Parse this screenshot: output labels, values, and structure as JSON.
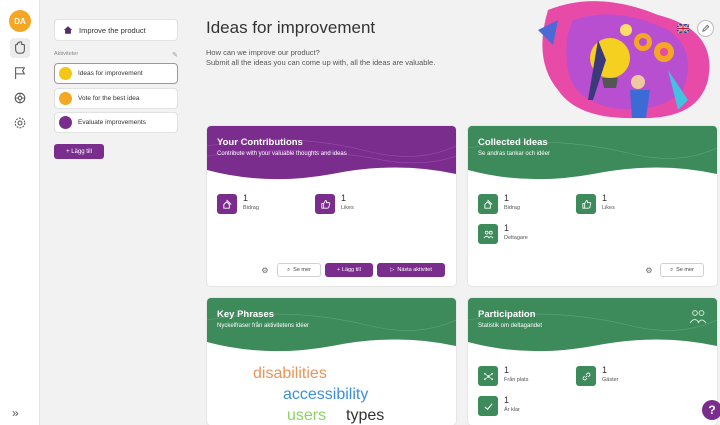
{
  "user": {
    "initials": "DA"
  },
  "sidebar": {
    "product_label": "Improve the product",
    "activities_heading": "Aktiviteter",
    "activities": [
      {
        "label": "Ideas for improvement",
        "color": "#f5c518"
      },
      {
        "label": "Vote for the best idea",
        "color": "#f5a623"
      },
      {
        "label": "Evaluate improvements",
        "color": "#7b2d8e"
      }
    ],
    "add_label": "+ Lägg till"
  },
  "header": {
    "title": "Ideas for improvement",
    "subtitle_line1": "How can we improve our product?",
    "subtitle_line2": "Submit all the ideas you can come up with, all the ideas are valuable."
  },
  "contributions": {
    "title": "Your Contributions",
    "subtitle": "Contribute with your valuable thoughts and ideas",
    "bidrag_count": "1",
    "bidrag_label": "Bidrag",
    "likes_count": "1",
    "likes_label": "Likes",
    "see_more": "Se mer",
    "add": "+ Lägg till",
    "next": "Nästa aktivitet"
  },
  "collected": {
    "title": "Collected Ideas",
    "subtitle": "Se andras tankar och idéer",
    "bidrag_count": "1",
    "bidrag_label": "Bidrag",
    "likes_count": "1",
    "likes_label": "Likes",
    "participants_count": "1",
    "participants_label": "Deltagare",
    "see_more": "Se mer"
  },
  "phrases": {
    "title": "Key Phrases",
    "subtitle": "Nyckelfraser från aktivitetens idéer",
    "words": [
      {
        "text": "disabilities",
        "color": "#e8955a"
      },
      {
        "text": "accessibility",
        "color": "#3d8fd6"
      },
      {
        "text": "users",
        "color": "#8bd45f"
      },
      {
        "text": "types",
        "color": "#333333"
      }
    ]
  },
  "participation": {
    "title": "Participation",
    "subtitle": "Statistik om deltagandet",
    "onsite_count": "1",
    "onsite_label": "Från plats",
    "guests_count": "1",
    "guests_label": "Gäster",
    "done_count": "1",
    "done_label": "Är klar"
  },
  "help_label": "?",
  "colors": {
    "purple": "#7b2d8e",
    "green": "#3d8a5a",
    "yellow": "#f5c518",
    "orange": "#f5a623"
  }
}
